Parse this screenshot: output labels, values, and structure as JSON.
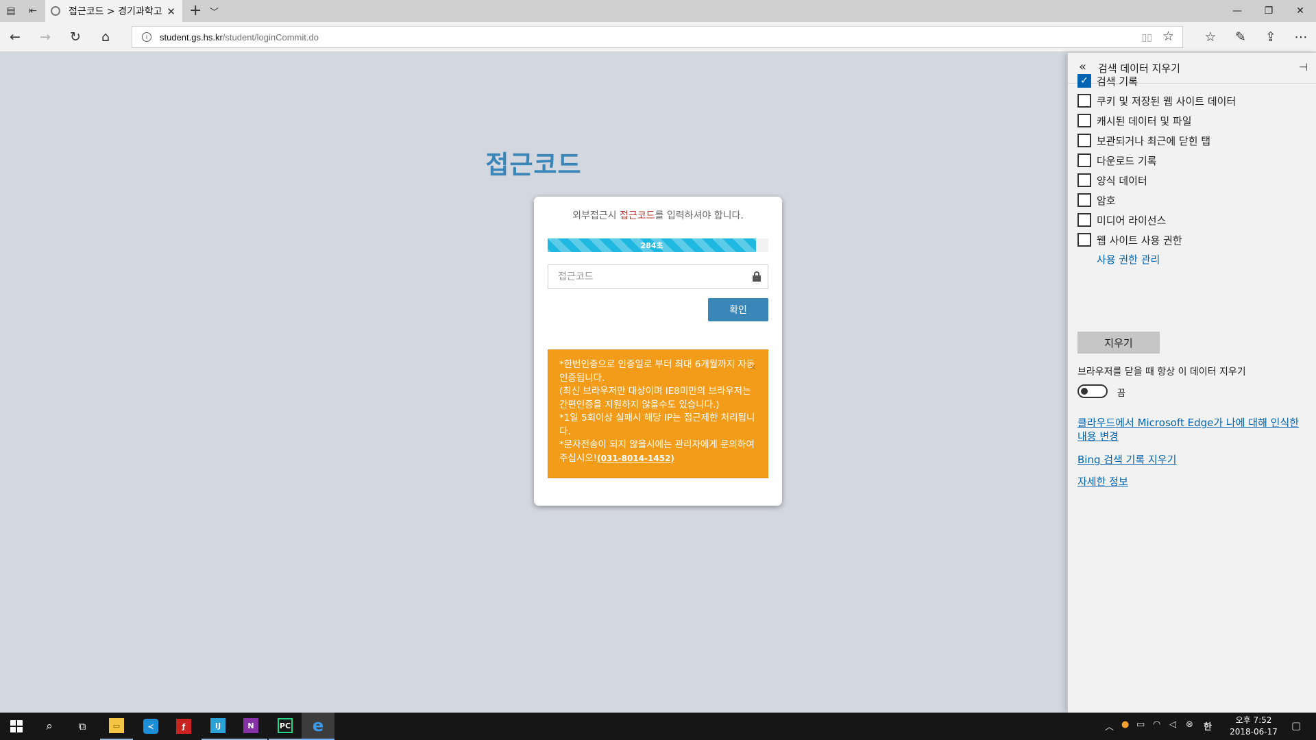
{
  "browser": {
    "tab_title": "접근코드 > 경기과학고",
    "tab_close": "✕",
    "new_tab": "+",
    "url_host": "student.gs.hs.kr",
    "url_path": "/student/loginCommit.do"
  },
  "page": {
    "heading": "접근코드",
    "message_pre": "외부접근시 ",
    "message_highlight": "접근코드",
    "message_post": "를 입력하셔야 합니다.",
    "timer_text": "284초",
    "timer_fraction": 0.945,
    "code_placeholder": "접근코드",
    "confirm_label": "확인",
    "notice": {
      "line1": "*한번인증으로 인증일로 부터 최대 6개월까지 자동인증됩니다.",
      "line2": "(최신 브라우저만 대상이며 IE8미만의 브라우저는 간편인증을 지원하지 않을수도 있습니다.)",
      "line3": "*1일 5회이상 실패시 해당 IP는 접근제한 처리됩니다.",
      "line4_pre": "*문자전송이 되지 않을시에는 관리자에게 문의하여 주십시오!",
      "phone": "(031-8014-1452)",
      "close": "×"
    },
    "colors": {
      "heading": "#3b86b8",
      "button": "#3b86b8",
      "notice": "#f39c1a",
      "progress": "#1fb8e0"
    }
  },
  "panel": {
    "title": "검색 데이터 지우기",
    "items": [
      {
        "label": "검색 기록",
        "checked": true
      },
      {
        "label": "쿠키 및 저장된 웹 사이트 데이터",
        "checked": false
      },
      {
        "label": "캐시된 데이터 및 파일",
        "checked": false
      },
      {
        "label": "보관되거나 최근에 닫힌 탭",
        "checked": false
      },
      {
        "label": "다운로드 기록",
        "checked": false
      },
      {
        "label": "양식 데이터",
        "checked": false
      },
      {
        "label": "암호",
        "checked": false
      },
      {
        "label": "미디어 라이선스",
        "checked": false
      },
      {
        "label": "웹 사이트 사용 권한",
        "checked": false
      }
    ],
    "manage_permissions": "사용 권한 관리",
    "clear_button": "지우기",
    "always_clear_label": "브라우저를 닫을 때 항상 이 데이터 지우기",
    "toggle_state": "끔",
    "link_cloud": "클라우드에서 Microsoft Edge가 나에 대해 인식한 내용 변경",
    "link_bing": "Bing 검색 기록 지우기",
    "link_more": "자세한 정보"
  },
  "taskbar": {
    "clock_time": "오후 7:52",
    "clock_date": "2018-06-17",
    "apps": [
      "file-explorer-icon",
      "visual-studio-code-icon",
      "adobe-flash-icon",
      "intellij-idea-icon",
      "onenote-icon",
      "pycharm-icon",
      "edge-icon"
    ]
  }
}
